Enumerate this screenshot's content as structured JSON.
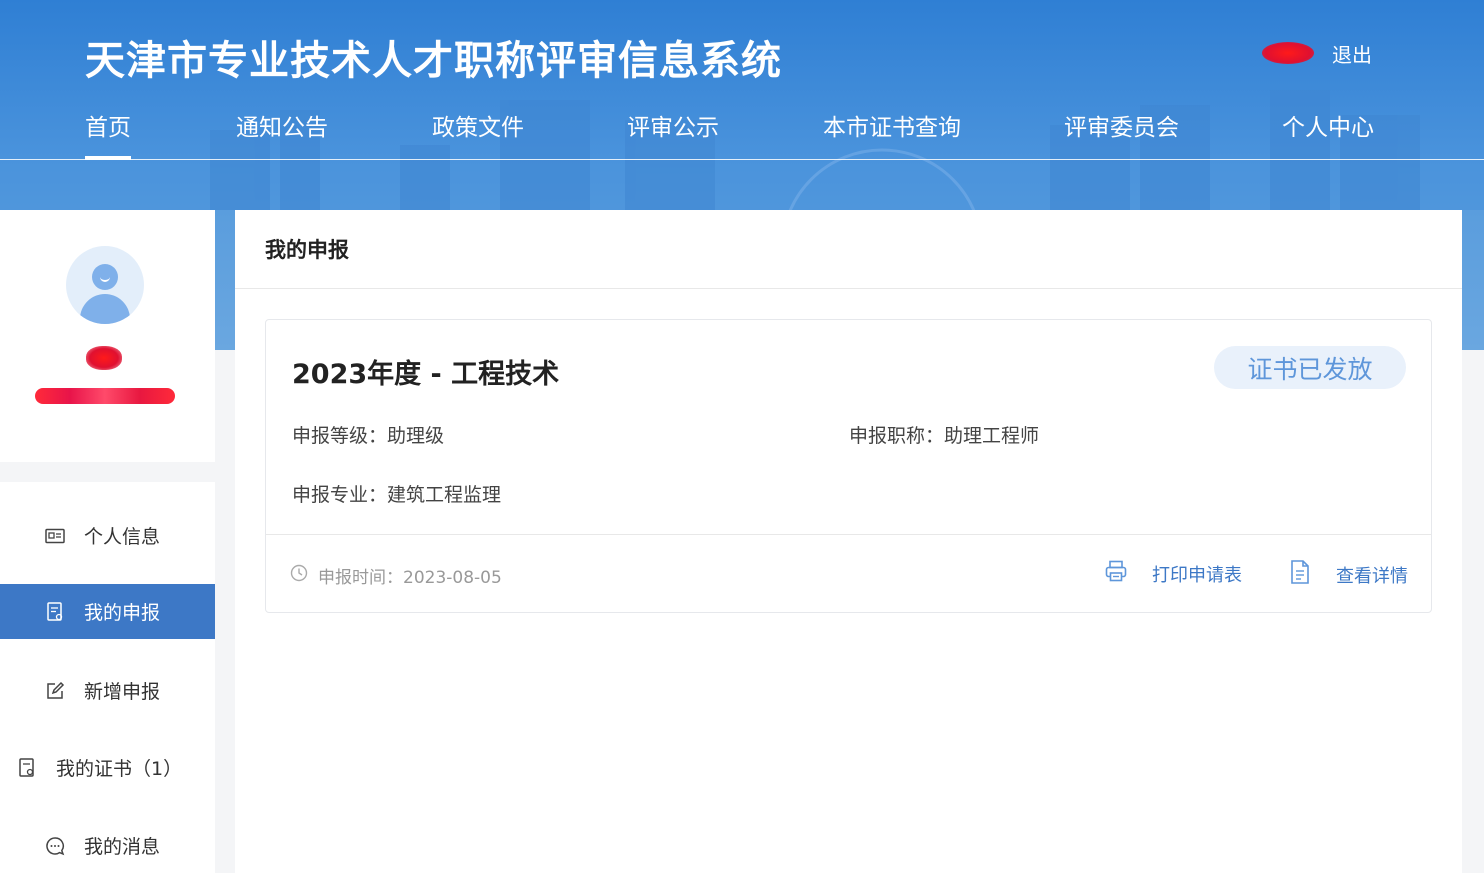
{
  "header": {
    "system_title": "天津市专业技术人才职称评审信息系统",
    "logout_label": "退出",
    "nav": [
      {
        "label": "首页",
        "active": true
      },
      {
        "label": "通知公告"
      },
      {
        "label": "政策文件"
      },
      {
        "label": "评审公示"
      },
      {
        "label": "本市证书查询"
      },
      {
        "label": "评审委员会"
      },
      {
        "label": "个人中心"
      }
    ]
  },
  "sidebar": {
    "menu": [
      {
        "label": "个人信息",
        "icon": "id-card-icon"
      },
      {
        "label": "我的申报",
        "icon": "application-doc-icon",
        "active": true
      },
      {
        "label": "新增申报",
        "icon": "edit-icon"
      },
      {
        "label": "我的证书（1）",
        "icon": "certificate-icon"
      },
      {
        "label": "我的消息",
        "icon": "message-icon"
      }
    ]
  },
  "main": {
    "title": "我的申报",
    "card": {
      "title": "2023年度 - 工程技术",
      "status": "证书已发放",
      "level": "申报等级：助理级",
      "job_title": "申报职称：助理工程师",
      "specialty": "申报专业：建筑工程监理",
      "submit_time": "申报时间：2023-08-05",
      "print_label": "打印申请表",
      "detail_label": "查看详情"
    }
  },
  "colors": {
    "header_blue": "#2f7fd4",
    "active_menu": "#3d78c6",
    "status_badge_bg": "#e9f1fb",
    "status_badge_text": "#5e96da",
    "link": "#3d78c6"
  }
}
